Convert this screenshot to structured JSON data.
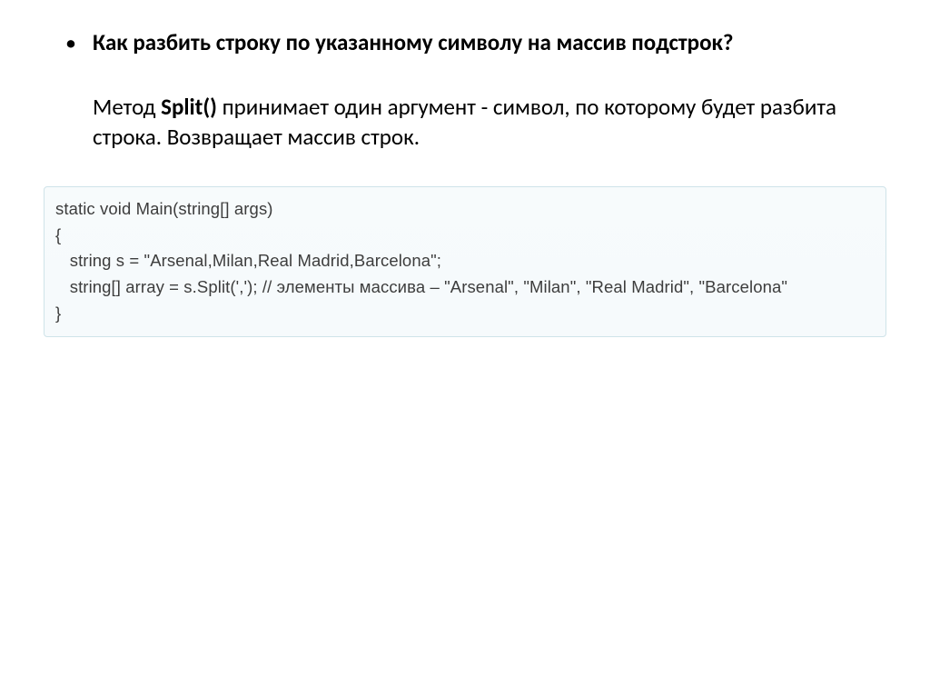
{
  "question": "Как разбить строку по указанному символу на массив подстрок?",
  "answer": {
    "prefix": "Метод ",
    "method": "Split()",
    "rest": " принимает один аргумент - символ, по которому будет разбита строка. Возвращает массив строк."
  },
  "code": {
    "line1": "static void Main(string[] args)",
    "line2": "{",
    "line3": "   string s = \"Arsenal,Milan,Real Madrid,Barcelona\";",
    "line4": "   string[] array = s.Split(','); // элементы массива – \"Arsenal\", \"Milan\", \"Real Madrid\", \"Barcelona\"",
    "line5": "}"
  }
}
